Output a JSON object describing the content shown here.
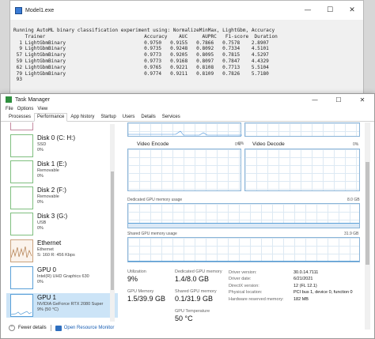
{
  "console": {
    "title": "Model1.exe",
    "lines": [
      "Running AutoML binary classification experiment using: NormalizeMinMax, LightGbm, Accuracy",
      "    Trainer                                  Accuracy    AUC     AUPRC   F1-score  Duration",
      "  1 LightGbmBinary                           0.9750   0.9155   0.7866   0.7578    2.8907",
      "  9 LightGbmBinary                           0.9735   0.9248   0.8092   0.7334    4.5101",
      " 57 LightGbmBinary                           0.9773   0.9205   0.8095   0.7815    4.5297",
      " 59 LightGbmBinary                           0.9773   0.9168   0.8097   0.7847    4.4329",
      " 62 LightGbmBinary                           0.9765   0.9221   0.8108   0.7713    5.5104",
      " 79 LightGbmBinary                           0.9774   0.9211   0.8109   0.7826    5.7180",
      " 93"
    ]
  },
  "taskmanager": {
    "title": "Task Manager",
    "menu": [
      "File",
      "Options",
      "View"
    ],
    "tabs": [
      "Processes",
      "Performance",
      "App history",
      "Startup",
      "Users",
      "Details",
      "Services"
    ],
    "active_tab": "Performance",
    "sidebar": [
      {
        "name": "Disk 0 (C: H:)",
        "sub1": "SSD",
        "sub2": "0%"
      },
      {
        "name": "Disk 1 (E:)",
        "sub1": "Removable",
        "sub2": "0%"
      },
      {
        "name": "Disk 2 (F:)",
        "sub1": "Removable",
        "sub2": "0%"
      },
      {
        "name": "Disk 3 (G:)",
        "sub1": "USB",
        "sub2": "0%"
      },
      {
        "name": "Ethernet",
        "sub1": "Ethernet",
        "sub2": "S: 160  R: 456 Kbps"
      },
      {
        "name": "GPU 0",
        "sub1": "Intel(R) UHD Graphics 630",
        "sub2": "0%"
      },
      {
        "name": "GPU 1",
        "sub1": "NVIDIA GeForce RTX 2080 Super",
        "sub2": "9% (50 °C)"
      }
    ],
    "graphs": {
      "video_encode": "Video Encode",
      "video_encode_pct": "0%",
      "video_decode": "Video Decode",
      "video_decode_pct": "0%",
      "top_pct": "0%",
      "dedicated": "Dedicated GPU memory usage",
      "dedicated_max": "8.0 GB",
      "shared": "Shared GPU memory usage",
      "shared_max": "31.9 GB"
    },
    "stats": {
      "utilization_label": "Utilization",
      "utilization": "9%",
      "dedicated_label": "Dedicated GPU memory",
      "dedicated": "1.4/8.0 GB",
      "gpu_memory_label": "GPU Memory",
      "gpu_memory": "1.5/39.9 GB",
      "shared_label": "Shared GPU memory",
      "shared": "0.1/31.9 GB",
      "temp_label": "GPU Temperature",
      "temp": "50 °C"
    },
    "properties": [
      {
        "k": "Driver version:",
        "v": "30.0.14.7111"
      },
      {
        "k": "Driver date:",
        "v": "6/21/2021"
      },
      {
        "k": "DirectX version:",
        "v": "12 (FL 12.1)"
      },
      {
        "k": "Physical location:",
        "v": "PCI bus 1, device 0, function 0"
      },
      {
        "k": "Hardware reserved memory:",
        "v": "182 MB"
      }
    ],
    "footer": {
      "fewer": "Fewer details",
      "monitor": "Open Resource Monitor"
    }
  }
}
